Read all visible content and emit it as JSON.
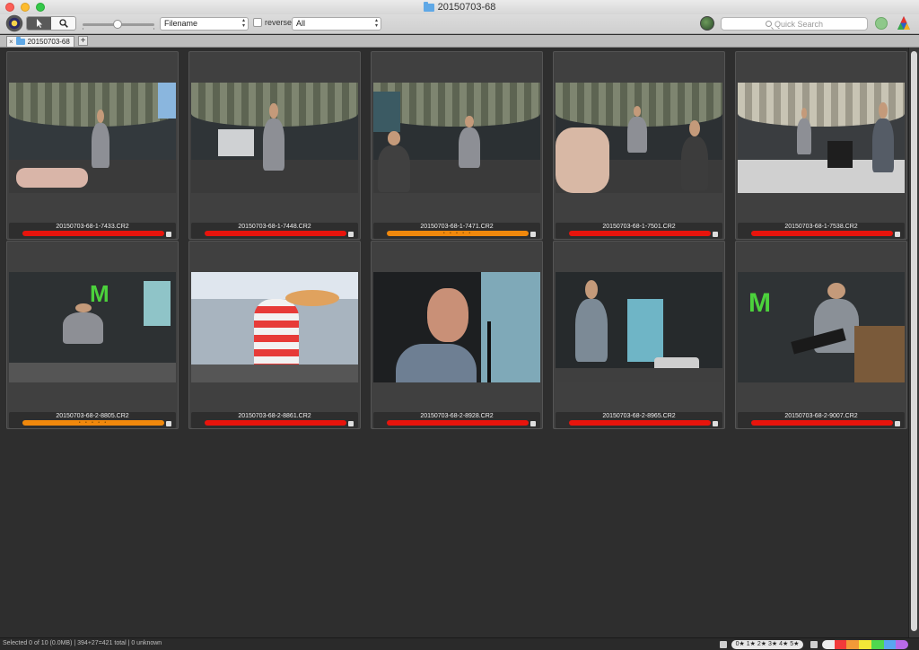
{
  "window": {
    "title": "20150703-68"
  },
  "toolbar": {
    "sort_field": "Filename",
    "reverse_label": "reverse",
    "filter_value": "All",
    "search_placeholder": "Quick Search"
  },
  "tabs": [
    {
      "label": "20150703-68"
    }
  ],
  "colors": {
    "red_label": "#e8140c",
    "orange_label": "#f0880c"
  },
  "thumbnails": [
    {
      "filename": "20150703-68-1-7433.CR2",
      "label_color": "red",
      "stars": ""
    },
    {
      "filename": "20150703-68-1-7448.CR2",
      "label_color": "red",
      "stars": ""
    },
    {
      "filename": "20150703-68-1-7471.CR2",
      "label_color": "orange",
      "stars": "• • • • •"
    },
    {
      "filename": "20150703-68-1-7501.CR2",
      "label_color": "red",
      "stars": ""
    },
    {
      "filename": "20150703-68-1-7538.CR2",
      "label_color": "red",
      "stars": ""
    },
    {
      "filename": "20150703-68-2-8805.CR2",
      "label_color": "orange",
      "stars": "• • • • •"
    },
    {
      "filename": "20150703-68-2-8861.CR2",
      "label_color": "red",
      "stars": ""
    },
    {
      "filename": "20150703-68-2-8928.CR2",
      "label_color": "red",
      "stars": ""
    },
    {
      "filename": "20150703-68-2-8965.CR2",
      "label_color": "red",
      "stars": ""
    },
    {
      "filename": "20150703-68-2-9007.CR2",
      "label_color": "red",
      "stars": ""
    }
  ],
  "status": {
    "text": "Selected 0 of 10 (0.0MB) | 394+27=421 total | 0 unknown",
    "stars_filter": "0★ 1★ 2★ 3★ 4★ 5★"
  }
}
